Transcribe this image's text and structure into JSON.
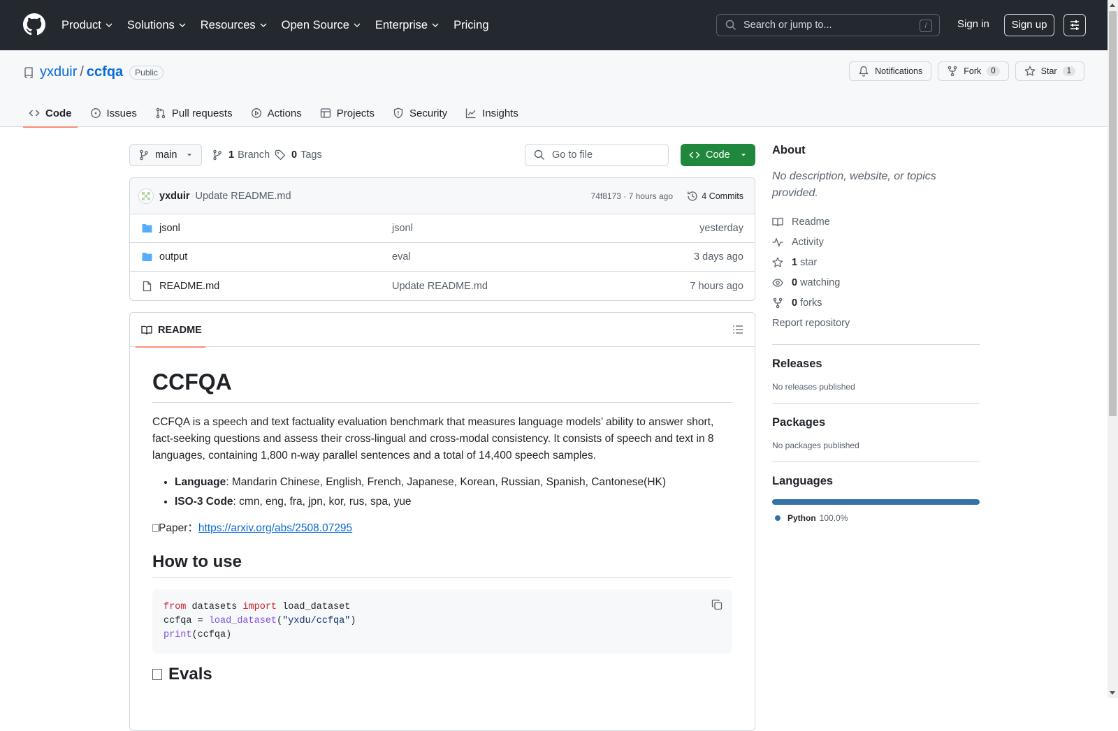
{
  "header": {
    "nav": [
      "Product",
      "Solutions",
      "Resources",
      "Open Source",
      "Enterprise",
      "Pricing"
    ],
    "search_placeholder": "Search or jump to...",
    "search_key": "/",
    "sign_in": "Sign in",
    "sign_up": "Sign up"
  },
  "repo": {
    "owner": "yxduir",
    "separator": "/",
    "name": "ccfqa",
    "visibility": "Public",
    "notifications_label": "Notifications",
    "fork_label": "Fork",
    "fork_count": "0",
    "star_label": "Star",
    "star_count": "1",
    "tabs": [
      "Code",
      "Issues",
      "Pull requests",
      "Actions",
      "Projects",
      "Security",
      "Insights"
    ]
  },
  "bar": {
    "branch": "main",
    "branch_count": "1",
    "branch_label": "Branch",
    "tag_count": "0",
    "tag_label": "Tags",
    "goto_placeholder": "Go to file",
    "code_button": "Code"
  },
  "commit": {
    "author": "yxduir",
    "message": "Update README.md",
    "hash_time": "74f8173 · 7 hours ago",
    "commits": "4 Commits"
  },
  "files": [
    {
      "name": "jsonl",
      "message": "jsonl",
      "date": "yesterday",
      "type": "folder"
    },
    {
      "name": "output",
      "message": "eval",
      "date": "3 days ago",
      "type": "folder"
    },
    {
      "name": "README.md",
      "message": "Update README.md",
      "date": "7 hours ago",
      "type": "file"
    }
  ],
  "readme": {
    "tab_label": "README",
    "title": "CCFQA",
    "intro": "CCFQA is a speech and text factuality evaluation benchmark that measures language models’ ability to answer short, fact-seeking questions and assess their cross-lingual and cross-modal consistency. It consists of speech and text in 8 languages, containing 1,800 n-way parallel sentences and a total of 14,400 speech samples.",
    "bullets": [
      {
        "label": "Language",
        "text": ": Mandarin Chinese, English, French, Japanese, Korean, Russian, Spanish, Cantonese(HK)"
      },
      {
        "label": "ISO-3 Code",
        "text": ": cmn, eng, fra, jpn, kor, rus, spa, yue"
      }
    ],
    "paper_label": "Paper：",
    "paper_link": "https://arxiv.org/abs/2508.07295",
    "how_to_use": "How to use",
    "code": {
      "l1_kw1": "from",
      "l1_mod": " datasets ",
      "l1_kw2": "import",
      "l1_rest": " load_dataset",
      "l2_var": "ccfqa = ",
      "l2_fn": "load_dataset",
      "l2_open": "(",
      "l2_str": "\"yxdu/ccfqa\"",
      "l2_close": ")",
      "l3_fn": "print",
      "l3_rest": "(ccfqa)"
    },
    "evals": "Evals"
  },
  "sidebar": {
    "about": "About",
    "description": "No description, website, or topics provided.",
    "readme": "Readme",
    "activity": "Activity",
    "stars_count": "1",
    "stars_label": "star",
    "watching_count": "0",
    "watching_label": "watching",
    "forks_count": "0",
    "forks_label": "forks",
    "report": "Report repository",
    "releases": "Releases",
    "releases_none": "No releases published",
    "packages": "Packages",
    "packages_none": "No packages published",
    "languages": "Languages",
    "lang_name": "Python",
    "lang_pct": "100.0%",
    "lang_color": "#3572a5"
  }
}
